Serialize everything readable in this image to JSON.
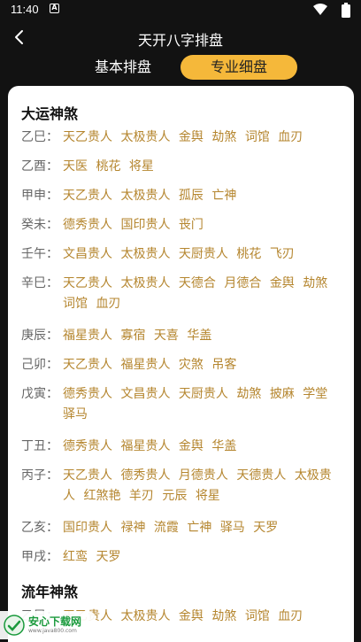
{
  "status_bar": {
    "time": "11:40",
    "notification_letter": "A"
  },
  "header": {
    "title": "天开八字排盘",
    "back_icon": "chevron-left-icon"
  },
  "tabs": [
    {
      "label": "基本排盘",
      "active": false
    },
    {
      "label": "专业细盘",
      "active": true
    }
  ],
  "colors": {
    "accent": "#f5b83a",
    "god_text": "#b5862f",
    "stem_text": "#666666",
    "background": "#121212"
  },
  "dayun": {
    "title": "大运神煞",
    "rows": [
      {
        "stem": "乙巳：",
        "gods": [
          "天乙贵人",
          "太极贵人",
          "金舆",
          "劫煞",
          "词馆",
          "血刃"
        ]
      },
      {
        "stem": "乙酉：",
        "gods": [
          "天医",
          "桃花",
          "将星"
        ]
      },
      {
        "stem": "甲申：",
        "gods": [
          "天乙贵人",
          "太极贵人",
          "孤辰",
          "亡神"
        ]
      },
      {
        "stem": "癸未：",
        "gods": [
          "德秀贵人",
          "国印贵人",
          "丧门"
        ]
      },
      {
        "stem": "壬午：",
        "gods": [
          "文昌贵人",
          "太极贵人",
          "天厨贵人",
          "桃花",
          "飞刃"
        ]
      },
      {
        "stem": "辛巳：",
        "gods": [
          "天乙贵人",
          "太极贵人",
          "天德合",
          "月德合",
          "金舆",
          "劫煞",
          "词馆",
          "血刃"
        ]
      },
      {
        "stem": "庚辰：",
        "gods": [
          "福星贵人",
          "寡宿",
          "天喜",
          "华盖"
        ]
      },
      {
        "stem": "己卯：",
        "gods": [
          "天乙贵人",
          "福星贵人",
          "灾煞",
          "吊客"
        ]
      },
      {
        "stem": "戊寅：",
        "gods": [
          "德秀贵人",
          "文昌贵人",
          "天厨贵人",
          "劫煞",
          "披麻",
          "学堂",
          "驿马"
        ]
      },
      {
        "stem": "丁丑：",
        "gods": [
          "德秀贵人",
          "福星贵人",
          "金舆",
          "华盖"
        ]
      },
      {
        "stem": "丙子：",
        "gods": [
          "天乙贵人",
          "德秀贵人",
          "月德贵人",
          "天德贵人",
          "太极贵人",
          "红煞艳",
          "羊刃",
          "元辰",
          "将星"
        ]
      },
      {
        "stem": "乙亥：",
        "gods": [
          "国印贵人",
          "禄神",
          "流霞",
          "亡神",
          "驿马",
          "天罗"
        ]
      },
      {
        "stem": "甲戌：",
        "gods": [
          "红鸾",
          "天罗"
        ]
      }
    ]
  },
  "liunian": {
    "title": "流年神煞",
    "rows": [
      {
        "stem": "乙巳：",
        "gods": [
          "天乙贵人",
          "太极贵人",
          "金舆",
          "劫煞",
          "词馆",
          "血刃"
        ]
      }
    ]
  },
  "watermark": {
    "brand": "安心下载网",
    "url": "www.java800.com"
  }
}
